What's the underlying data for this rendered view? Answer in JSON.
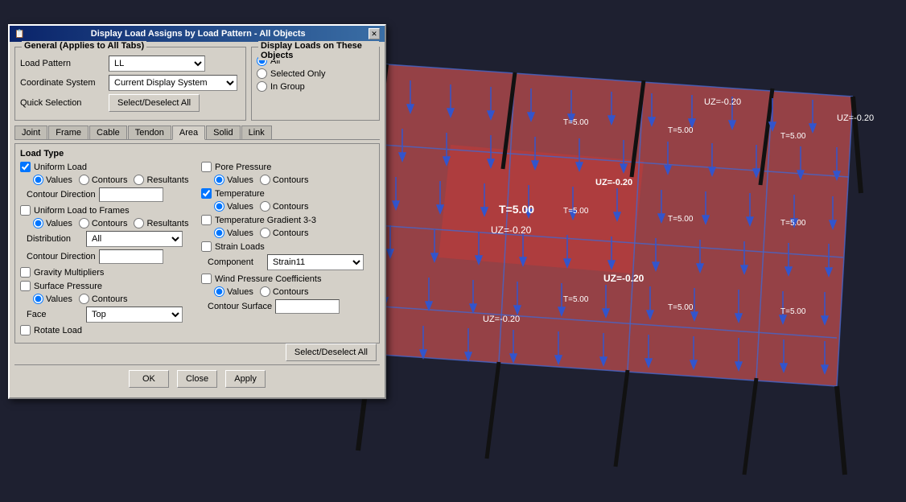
{
  "visualization": {
    "background_color": "#2a2a3a"
  },
  "dialog": {
    "title": "Display Load Assigns by Load Pattern - All Objects",
    "close_button": "✕",
    "general_section_label": "General  (Applies to All Tabs)",
    "load_pattern_label": "Load Pattern",
    "load_pattern_value": "LL",
    "coordinate_system_label": "Coordinate System",
    "coordinate_system_value": "Current Display System",
    "quick_selection_label": "Quick Selection",
    "select_deselect_all_label": "Select/Deselect All",
    "display_loads_label": "Display Loads on These Objects",
    "display_all_label": "All",
    "display_selected_label": "Selected Only",
    "display_ingroup_label": "In Group",
    "tabs": [
      "Joint",
      "Frame",
      "Cable",
      "Tendon",
      "Area",
      "Solid",
      "Link"
    ],
    "active_tab": "Area",
    "load_type_label": "Load Type",
    "uniform_load_label": "Uniform Load",
    "uniform_load_checked": true,
    "values_label1": "Values",
    "contours_label1": "Contours",
    "resultants_label1": "Resultants",
    "contour_direction_label": "Contour Direction",
    "uniform_frames_label": "Uniform Load to Frames",
    "uniform_frames_checked": false,
    "values_label2": "Values",
    "contours_label2": "Contours",
    "resultants_label2": "Resultants",
    "distribution_label": "Distribution",
    "distribution_value": "All",
    "contour_direction_label2": "Contour Direction",
    "gravity_multipliers_label": "Gravity Multipliers",
    "gravity_checked": false,
    "surface_pressure_label": "Surface Pressure",
    "surface_checked": false,
    "sp_values_label": "Values",
    "sp_contours_label": "Contours",
    "face_label": "Face",
    "face_value": "Top",
    "rotate_load_label": "Rotate Load",
    "rotate_checked": false,
    "pore_pressure_label": "Pore Pressure",
    "pore_checked": false,
    "pp_values_label": "Values",
    "pp_contours_label": "Contours",
    "temperature_label": "Temperature",
    "temp_checked": true,
    "temp_values_label": "Values",
    "temp_contours_label": "Contours",
    "temp_gradient_label": "Temperature Gradient 3-3",
    "tg_checked": false,
    "tg_values_label": "Values",
    "tg_contours_label": "Contours",
    "strain_loads_label": "Strain Loads",
    "strain_checked": false,
    "component_label": "Component",
    "component_value": "Strain11",
    "wind_pressure_label": "Wind Pressure Coefficients",
    "wind_checked": false,
    "wind_values_label": "Values",
    "wind_contours_label": "Contours",
    "contour_surface_label": "Contour Surface",
    "select_deselect_bottom": "Select/Deselect All",
    "ok_label": "OK",
    "close_label": "Close",
    "apply_label": "Apply"
  }
}
